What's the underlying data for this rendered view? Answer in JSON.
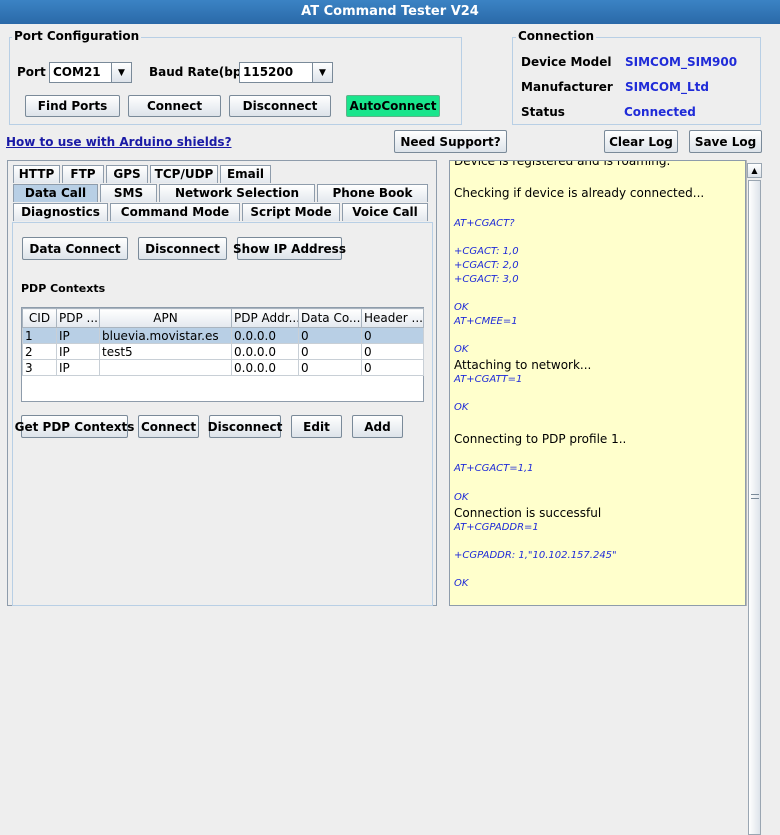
{
  "window": {
    "title": "AT Command Tester V24"
  },
  "port_config": {
    "legend": "Port Configuration",
    "port_label": "Port",
    "port_value": "COM21",
    "baud_label": "Baud Rate(bps)",
    "baud_value": "115200",
    "find_ports": "Find Ports",
    "connect": "Connect",
    "disconnect": "Disconnect",
    "autoconnect": "AutoConnect"
  },
  "connection": {
    "legend": "Connection",
    "device_model_label": "Device Model",
    "device_model_value": "SIMCOM_SIM900",
    "manufacturer_label": "Manufacturer",
    "manufacturer_value": "SIMCOM_Ltd",
    "status_label": "Status",
    "status_value": "Connected"
  },
  "toolbar": {
    "arduino_link": "How to use with Arduino shields?",
    "need_support": "Need Support?",
    "clear_log": "Clear Log",
    "save_log": "Save Log"
  },
  "tabs": {
    "row1": [
      "HTTP",
      "FTP",
      "GPS",
      "TCP/UDP",
      "Email"
    ],
    "row2": [
      "Data Call",
      "SMS",
      "Network Selection",
      "Phone Book"
    ],
    "row3": [
      "Diagnostics",
      "Command Mode",
      "Script Mode",
      "Voice Call"
    ]
  },
  "data_call": {
    "data_connect": "Data Connect",
    "disconnect": "Disconnect",
    "show_ip": "Show IP Address",
    "pdp_title": "PDP Contexts",
    "columns": [
      "CID",
      "PDP ...",
      "APN",
      "PDP Addr...",
      "Data Co...",
      "Header ..."
    ],
    "rows": [
      [
        "1",
        "IP",
        "bluevia.movistar.es",
        "0.0.0.0",
        "0",
        "0"
      ],
      [
        "2",
        "IP",
        "test5",
        "0.0.0.0",
        "0",
        "0"
      ],
      [
        "3",
        "IP",
        "",
        "0.0.0.0",
        "0",
        "0"
      ]
    ],
    "get_pdp": "Get PDP Contexts",
    "connect": "Connect",
    "disconnect2": "Disconnect",
    "edit": "Edit",
    "add": "Add"
  },
  "log": [
    {
      "text": "Device is registered and is roaming.",
      "kind": "msg"
    },
    {
      "text": "Checking if device is already connected...",
      "kind": "msg"
    },
    {
      "text": "AT+CGACT?",
      "kind": "cmd"
    },
    {
      "text": "+CGACT: 1,0",
      "kind": "cmd"
    },
    {
      "text": "+CGACT: 2,0",
      "kind": "cmd"
    },
    {
      "text": "+CGACT: 3,0",
      "kind": "cmd"
    },
    {
      "text": "OK",
      "kind": "cmd"
    },
    {
      "text": "AT+CMEE=1",
      "kind": "cmd"
    },
    {
      "text": "OK",
      "kind": "cmd"
    },
    {
      "text": "Attaching to network...",
      "kind": "msg"
    },
    {
      "text": "AT+CGATT=1",
      "kind": "cmd"
    },
    {
      "text": "OK",
      "kind": "cmd"
    },
    {
      "text": "Connecting to PDP profile 1..",
      "kind": "msg"
    },
    {
      "text": "AT+CGACT=1,1",
      "kind": "cmd"
    },
    {
      "text": "OK",
      "kind": "cmd"
    },
    {
      "text": "Connection is successful",
      "kind": "msg"
    },
    {
      "text": "AT+CGPADDR=1",
      "kind": "cmd"
    },
    {
      "text": "+CGPADDR: 1,\"10.102.157.245\"",
      "kind": "cmd"
    },
    {
      "text": "OK",
      "kind": "cmd"
    }
  ]
}
